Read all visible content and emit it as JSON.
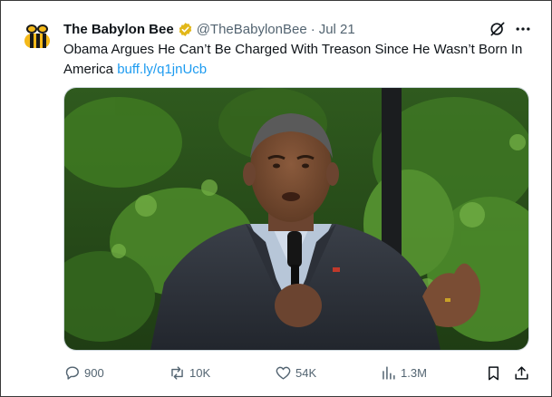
{
  "tweet": {
    "display_name": "The Babylon Bee",
    "handle": "@TheBabylonBee",
    "separator": "·",
    "date": "Jul 21",
    "text": "Obama Argues He Can’t Be Charged With Treason Since He Wasn’t Born In America",
    "link": "buff.ly/q1jnUcb",
    "verified_color": "#e2b719",
    "link_color": "#1d9bf0"
  },
  "actions": {
    "replies": "900",
    "reposts": "10K",
    "likes": "54K",
    "views": "1.3M"
  },
  "icons": {
    "avatar": "babylon-bee-logo",
    "verified": "verified-badge-icon",
    "grok": "grok-icon",
    "more": "more-icon",
    "reply": "reply-icon",
    "repost": "repost-icon",
    "like": "like-icon",
    "views": "views-icon",
    "bookmark": "bookmark-icon",
    "share": "share-icon"
  }
}
